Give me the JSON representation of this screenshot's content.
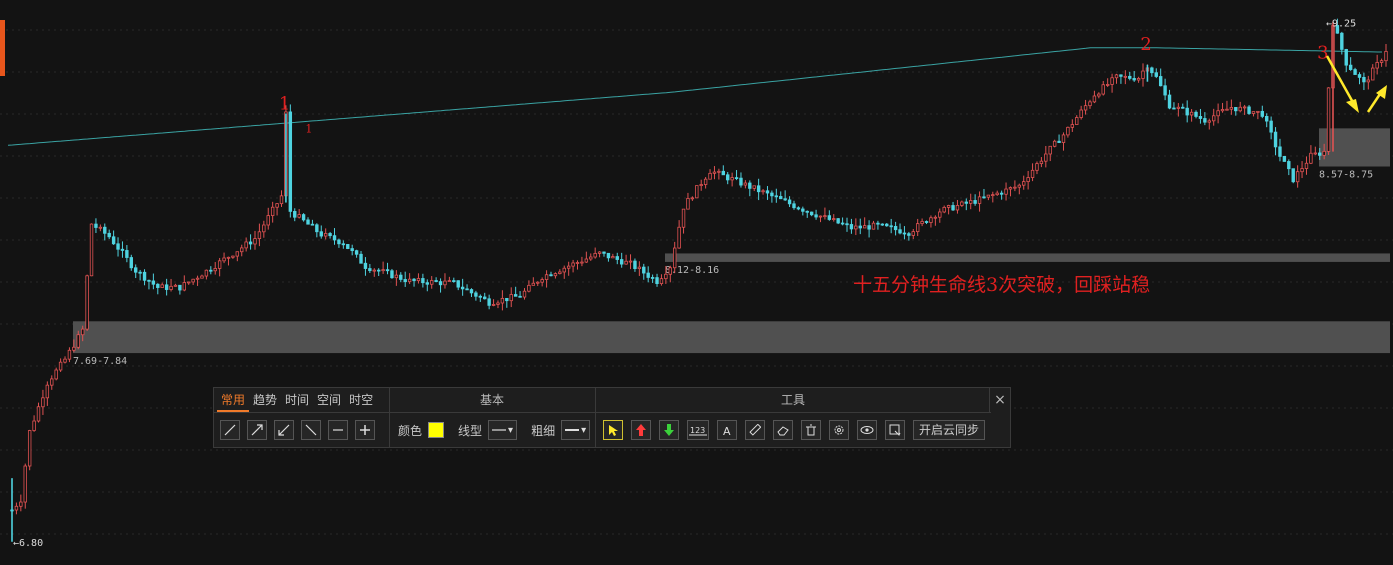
{
  "chart_data": {
    "type": "candlestick",
    "instrument_interval_note": "十五分钟生命线3次突破，回踩站稳",
    "price_markers": {
      "high_label": "9.25",
      "low_label": "6.80"
    },
    "zones": [
      {
        "label": "7.69-7.84",
        "low": 7.69,
        "high": 7.84
      },
      {
        "label": "8.12-8.16",
        "low": 8.12,
        "high": 8.16
      },
      {
        "label": "8.57-8.75",
        "low": 8.57,
        "high": 8.75
      }
    ],
    "annotations": [
      {
        "text": "1",
        "bar": 62,
        "price": 8.82
      },
      {
        "text": "1",
        "bar": 68,
        "price": 8.73
      },
      {
        "text": "2",
        "bar": 257,
        "price": 9.1
      },
      {
        "text": "3",
        "bar": 297,
        "price": 9.06
      }
    ],
    "ylim": [
      6.78,
      9.28
    ],
    "n_bars": 312,
    "close_keyframes": [
      [
        0,
        6.95
      ],
      [
        2,
        7.0
      ],
      [
        4,
        7.32
      ],
      [
        8,
        7.55
      ],
      [
        12,
        7.66
      ],
      [
        16,
        7.8
      ],
      [
        18,
        8.3
      ],
      [
        22,
        8.24
      ],
      [
        28,
        8.08
      ],
      [
        33,
        8.0
      ],
      [
        38,
        8.0
      ],
      [
        45,
        8.09
      ],
      [
        50,
        8.16
      ],
      [
        55,
        8.23
      ],
      [
        61,
        8.43
      ],
      [
        62,
        8.82
      ],
      [
        63,
        8.36
      ],
      [
        70,
        8.25
      ],
      [
        75,
        8.21
      ],
      [
        80,
        8.1
      ],
      [
        90,
        8.03
      ],
      [
        100,
        8.02
      ],
      [
        108,
        7.93
      ],
      [
        115,
        7.96
      ],
      [
        120,
        8.05
      ],
      [
        127,
        8.11
      ],
      [
        133,
        8.16
      ],
      [
        140,
        8.11
      ],
      [
        146,
        8.03
      ],
      [
        149,
        8.1
      ],
      [
        152,
        8.38
      ],
      [
        158,
        8.55
      ],
      [
        163,
        8.51
      ],
      [
        172,
        8.43
      ],
      [
        180,
        8.36
      ],
      [
        190,
        8.28
      ],
      [
        196,
        8.29
      ],
      [
        203,
        8.26
      ],
      [
        210,
        8.36
      ],
      [
        220,
        8.42
      ],
      [
        228,
        8.48
      ],
      [
        234,
        8.63
      ],
      [
        238,
        8.72
      ],
      [
        245,
        8.91
      ],
      [
        250,
        8.99
      ],
      [
        255,
        8.99
      ],
      [
        257,
        9.05
      ],
      [
        259,
        8.99
      ],
      [
        262,
        8.86
      ],
      [
        270,
        8.79
      ],
      [
        276,
        8.85
      ],
      [
        283,
        8.82
      ],
      [
        287,
        8.62
      ],
      [
        290,
        8.51
      ],
      [
        294,
        8.62
      ],
      [
        297,
        8.64
      ],
      [
        299,
        9.25
      ],
      [
        302,
        9.06
      ],
      [
        306,
        8.96
      ],
      [
        310,
        9.08
      ],
      [
        311,
        9.12
      ]
    ],
    "ma_line": {
      "color": "#3aa3a3",
      "keyframes": [
        [
          0,
          8.67
        ],
        [
          60,
          8.77
        ],
        [
          150,
          8.92
        ],
        [
          245,
          9.13
        ],
        [
          260,
          9.13
        ],
        [
          311,
          9.11
        ]
      ]
    },
    "colors": {
      "up": "#e05252",
      "down": "#4fd3e0",
      "zone": "#505050",
      "annotation": "#e02020",
      "arrow": "#ffe92b",
      "grid": "#2a2a2a"
    }
  },
  "toolbar": {
    "tabs": [
      "常用",
      "趋势",
      "时间",
      "空间",
      "时空"
    ],
    "active_tab": "常用",
    "section_basic": "基本",
    "section_tools": "工具",
    "color_label": "颜色",
    "line_type_label": "线型",
    "thickness_label": "粗细",
    "sync_button": "开启云同步",
    "close": "×"
  }
}
